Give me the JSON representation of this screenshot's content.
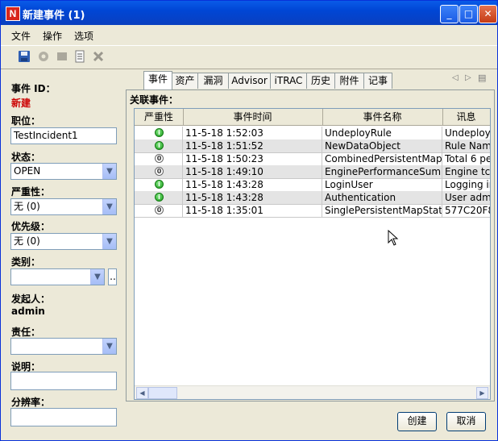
{
  "window": {
    "title": "新建事件 (1)",
    "app_icon": "N"
  },
  "menu": [
    "文件",
    "操作",
    "选项"
  ],
  "toolbar": {
    "icons": [
      "save-icon",
      "gear-icon",
      "stop-icon",
      "notes-icon",
      "delete-icon"
    ]
  },
  "left": {
    "event_id_label": "事件 ID：",
    "event_id_value": "新建",
    "position_label": "职位：",
    "position_value": "TestIncident1",
    "status_label": "状态：",
    "status_value": "OPEN",
    "severity_label": "严重性：",
    "severity_value": "无 (0)",
    "priority_label": "优先级：",
    "priority_value": "无 (0)",
    "category_label": "类别：",
    "category_value": "",
    "browse_label": "..",
    "initiator_label": "发起人：",
    "initiator_value": "admin",
    "owner_label": "责任：",
    "owner_value": "",
    "description_label": "说明：",
    "description_value": "",
    "resolution_label": "分辨率：",
    "resolution_value": ""
  },
  "tabs": [
    "事件",
    "资产",
    "漏洞",
    "Advisor",
    "iTRAC",
    "历史",
    "附件",
    "记事"
  ],
  "panel": {
    "related_label": "关联事件：",
    "columns": [
      "严重性",
      "事件时间",
      "事件名称",
      "讯息"
    ],
    "rows": [
      {
        "sev": "green",
        "time": "11-5-18 1:52:03",
        "name": "UndeployRule",
        "msg": "Undeploy"
      },
      {
        "sev": "green",
        "time": "11-5-18 1:51:52",
        "name": "NewDataObject",
        "msg": "Rule Nam"
      },
      {
        "sev": "white",
        "time": "11-5-18 1:50:23",
        "name": "CombinedPersistentMap...",
        "msg": "Total 6 pe"
      },
      {
        "sev": "white",
        "time": "11-5-18 1:49:10",
        "name": "EnginePerformanceSum...",
        "msg": "Engine tch"
      },
      {
        "sev": "green",
        "time": "11-5-18 1:43:28",
        "name": "LoginUser",
        "msg": "Logging in"
      },
      {
        "sev": "green",
        "time": "11-5-18 1:43:28",
        "name": "Authentication",
        "msg": "User adm"
      },
      {
        "sev": "white",
        "time": "11-5-18 1:35:01",
        "name": "SinglePersistentMapStatus",
        "msg": "577C20F8"
      }
    ]
  },
  "buttons": {
    "create": "创建",
    "cancel": "取消"
  },
  "colors": {
    "title_bar": "#0a5be8",
    "required_red": "#cc0000",
    "sev_green": "#1d9a1d"
  }
}
